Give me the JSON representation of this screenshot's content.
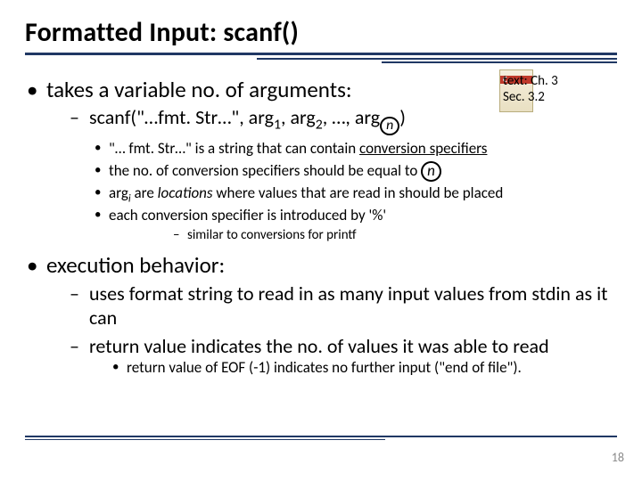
{
  "title": "Formatted Input: scanf()",
  "textref": {
    "line1": "text: Ch. 3",
    "line2": "Sec. 3.2"
  },
  "b1": {
    "lead": "takes a variable no. of arguments:",
    "sig": {
      "pre": "scanf(\"…fmt. Str…\", arg",
      "s1": "1",
      "mid1": ", arg",
      "s2": "2",
      "mid2": ", …, arg",
      "sn": "n",
      "post": ")"
    },
    "pts": {
      "p1a": "\"… fmt. Str…\" is a string that can contain ",
      "p1b": "conversion specifiers",
      "p2a": "the no. of conversion specifiers should be equal to ",
      "p2b": "n",
      "p3a": "arg",
      "p3sub": "i",
      "p3b": " are ",
      "p3c": "locations",
      "p3d": " where values that are read in should be placed",
      "p4": "each conversion specifier is introduced by '%'",
      "p4s": "similar to conversions for printf"
    }
  },
  "b2": {
    "lead": "execution behavior:",
    "s1": "uses format string to read in as many input values from stdin as it can",
    "s2": "return value indicates the no. of values it was able to read",
    "s2a": "return value of EOF (-1) indicates no further input (\"end of file\")."
  },
  "pagenum": "18"
}
